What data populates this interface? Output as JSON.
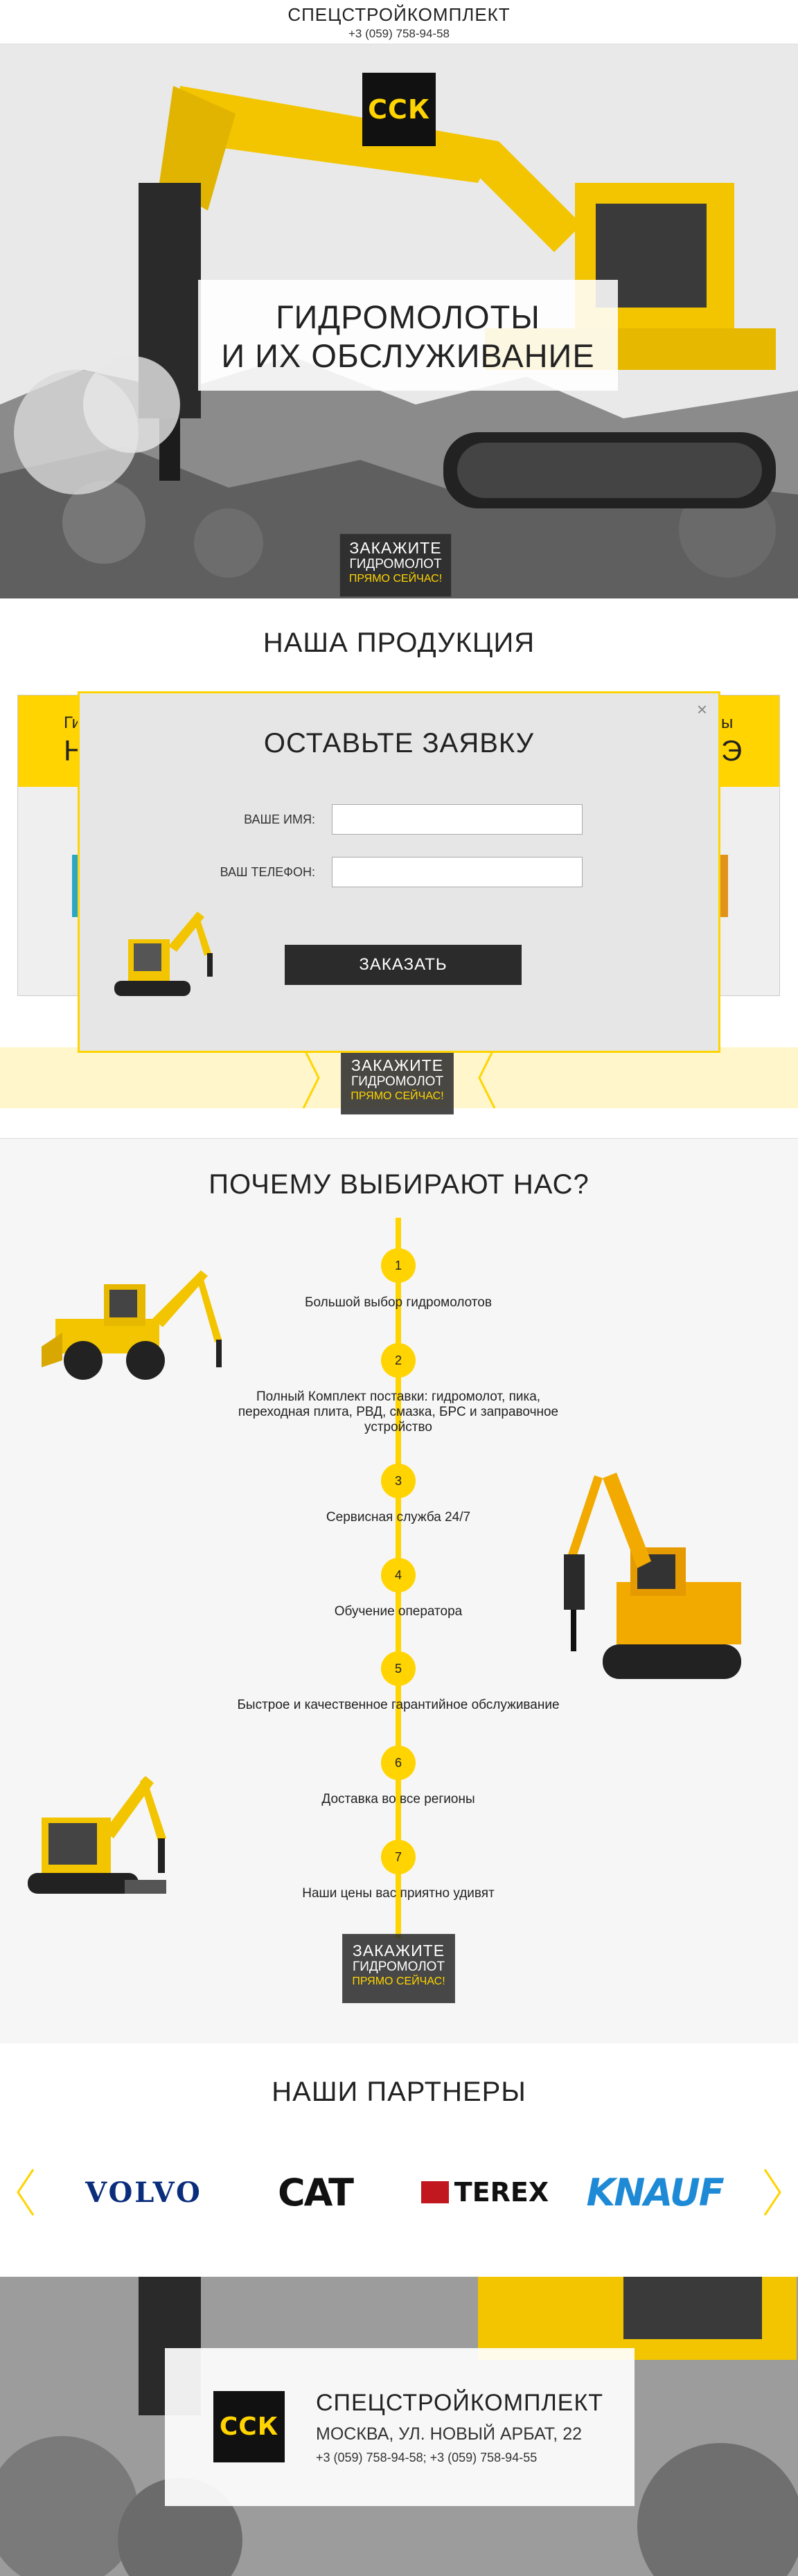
{
  "header": {
    "brand": "СПЕЦСТРОЙКОМПЛЕКТ",
    "phone": "+3 (059) 758-94-58"
  },
  "logo": {
    "text": "ССК"
  },
  "hero": {
    "title_line1": "ГИДРОМОЛОТЫ",
    "title_line2": "И ИХ ОБСЛУЖИВАНИЕ"
  },
  "cta": {
    "line1": "ЗАКАЖИТЕ",
    "line2": "ГИДРОМОЛОТ",
    "line3": "ПРЯМО СЕЙЧАС!"
  },
  "products": {
    "title": "НАША ПРОДУКЦИЯ",
    "left_card_partial": "Ги",
    "left_card_big_partial": "Н",
    "right_card_partial": "ы",
    "right_card_big_partial": "Э"
  },
  "modal": {
    "title": "ОСТАВЬТЕ ЗАЯВКУ",
    "close_glyph": "×",
    "name_label": "ВАШЕ ИМЯ:",
    "phone_label": "ВАШ ТЕЛЕФОН:",
    "name_value": "",
    "phone_value": "",
    "submit_label": "ЗАКАЗАТЬ"
  },
  "why": {
    "title": "ПОЧЕМУ ВЫБИРАЮТ НАС?",
    "steps": [
      {
        "num": "1",
        "text": "Большой выбор гидромолотов"
      },
      {
        "num": "2",
        "text": "Полный Комплект поставки: гидромолот, пика, переходная плита, РВД, смазка, БРС и заправочное устройство"
      },
      {
        "num": "3",
        "text": "Сервисная служба 24/7"
      },
      {
        "num": "4",
        "text": "Обучение оператора"
      },
      {
        "num": "5",
        "text": "Быстрое и качественное гарантийное обслуживание"
      },
      {
        "num": "6",
        "text": "Доставка во все регионы"
      },
      {
        "num": "7",
        "text": "Наши цены вас приятно удивят"
      }
    ]
  },
  "partners": {
    "title": "НАШИ ПАРТНЕРЫ",
    "items": [
      "VOLVO",
      "CAT",
      "TEREX",
      "KNAUF"
    ],
    "prev_icon": "chevron-left-icon",
    "next_icon": "chevron-right-icon"
  },
  "footer": {
    "brand": "СПЕЦСТРОЙКОМПЛЕКТ",
    "address": "МОСКВА, УЛ. НОВЫЙ АРБАТ, 22",
    "phones": "+3 (059) 758-94-58; +3 (059) 758-94-55"
  },
  "colors": {
    "accent_yellow": "#ffd400",
    "dark": "#2b2b2b",
    "light_bg": "#f6f6f6",
    "pale_yellow": "#fff6cc",
    "volvo_blue": "#0b2e7c",
    "knauf_blue": "#1e8ad6",
    "terex_red": "#c0181e"
  }
}
